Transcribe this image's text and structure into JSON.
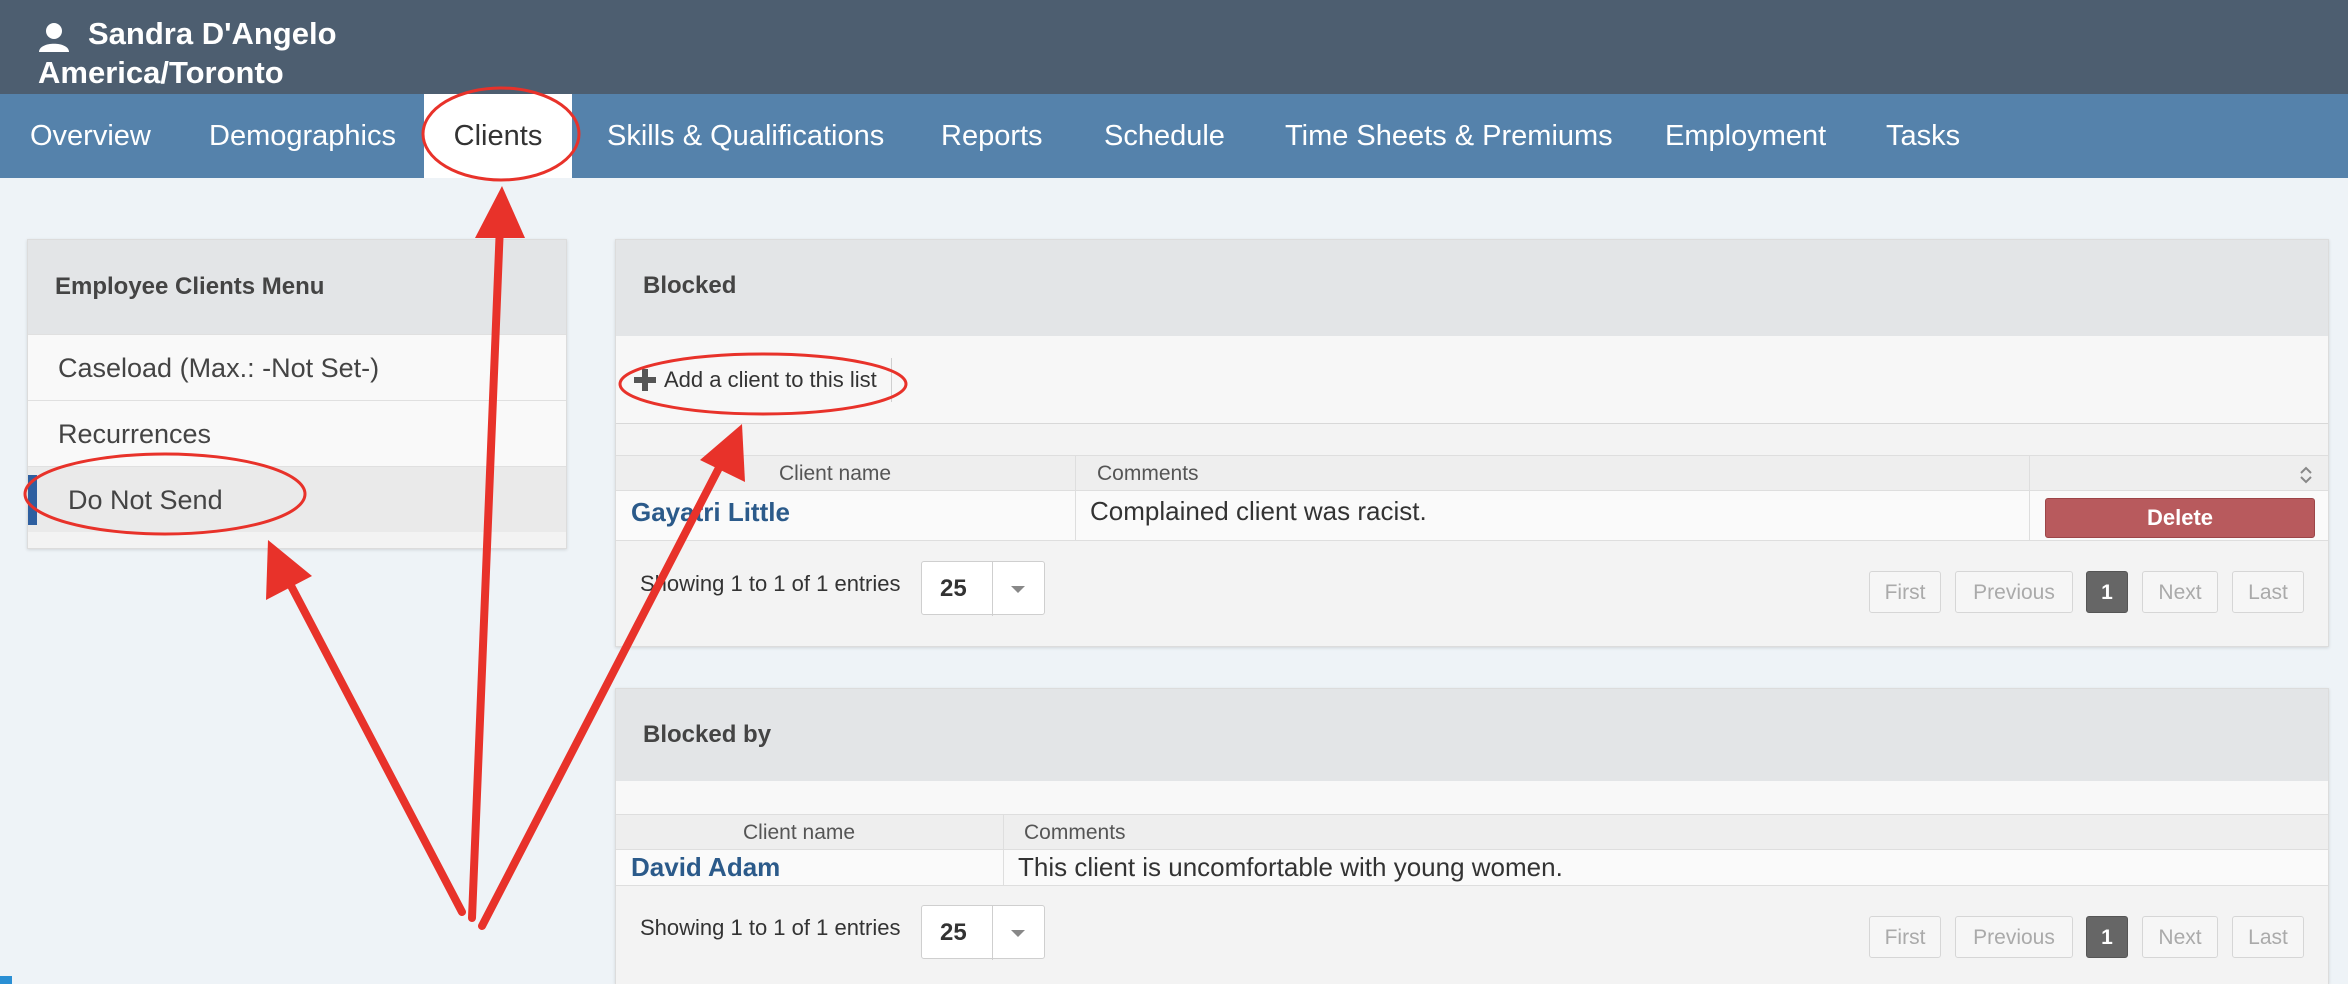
{
  "header": {
    "user_name": "Sandra D'Angelo",
    "timezone": "America/Toronto"
  },
  "nav": {
    "tabs": [
      {
        "label": "Overview"
      },
      {
        "label": "Demographics"
      },
      {
        "label": "Clients"
      },
      {
        "label": "Skills & Qualifications"
      },
      {
        "label": "Reports"
      },
      {
        "label": "Schedule"
      },
      {
        "label": "Time Sheets & Premiums"
      },
      {
        "label": "Employment"
      },
      {
        "label": "Tasks"
      }
    ],
    "active": "Clients"
  },
  "sidebar": {
    "title": "Employee Clients Menu",
    "items": [
      {
        "label": "Caseload (Max.: -Not Set-)"
      },
      {
        "label": "Recurrences"
      },
      {
        "label": "Do Not Send"
      }
    ]
  },
  "blocked": {
    "title": "Blocked",
    "add_label": "Add a client to this list",
    "columns": [
      "Client name",
      "Comments"
    ],
    "rows": [
      {
        "client": "Gayatri Little",
        "comment": "Complained client was racist.",
        "action": "Delete"
      }
    ],
    "showing": "Showing 1 to 1 of 1 entries",
    "page_size": "25",
    "pagination": [
      "First",
      "Previous",
      "1",
      "Next",
      "Last"
    ]
  },
  "blocked_by": {
    "title": "Blocked by",
    "columns": [
      "Client name",
      "Comments"
    ],
    "rows": [
      {
        "client": "David Adam",
        "comment": "This client is uncomfortable with young women."
      }
    ],
    "showing": "Showing 1 to 1 of 1 entries",
    "page_size": "25",
    "pagination": [
      "First",
      "Previous",
      "1",
      "Next",
      "Last"
    ]
  },
  "colors": {
    "header_bg": "#4d5e70",
    "nav_bg": "#5582ab",
    "link": "#2b5a8a",
    "delete": "#b85a5d",
    "annotation": "#e8322a"
  }
}
